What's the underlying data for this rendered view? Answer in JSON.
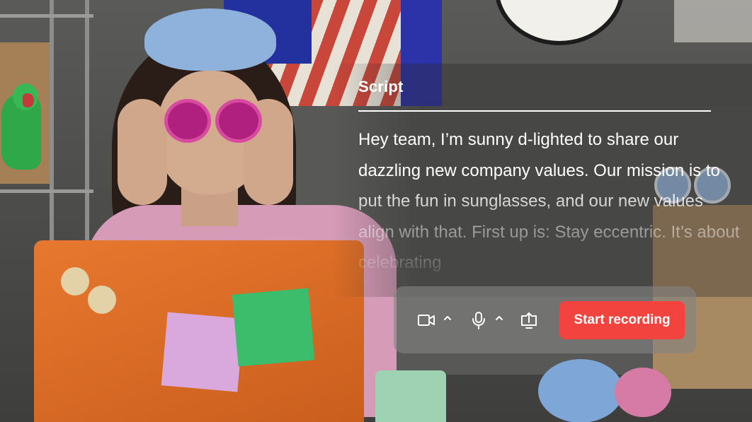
{
  "script_panel": {
    "title": "Script",
    "text": "Hey team, I’m sunny d-lighted to share our dazzling new company values. Our mission is to put the fun in sunglasses, and our new values align with that. First up is: Stay eccentric. It’s about celebrating"
  },
  "controls": {
    "camera_icon": "video-camera-icon",
    "camera_menu_icon": "chevron-up-icon",
    "microphone_icon": "microphone-icon",
    "microphone_menu_icon": "chevron-up-icon",
    "share_screen_icon": "share-screen-icon",
    "start_recording_label": "Start recording"
  },
  "colors": {
    "record_button": "#f2433f",
    "control_bar": "rgba(130,130,130,0.62)",
    "text": "#ffffff"
  }
}
